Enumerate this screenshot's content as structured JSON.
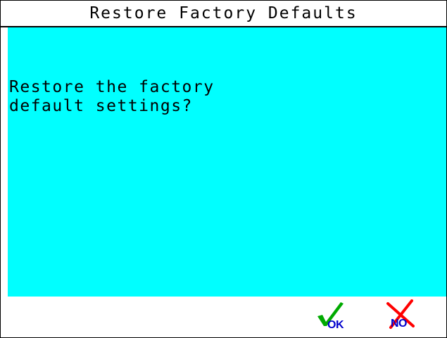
{
  "title": "Restore Factory Defaults",
  "message": {
    "line1": "Restore the factory",
    "line2": "default settings?"
  },
  "buttons": {
    "ok": {
      "label": "OK",
      "icon": "checkmark-icon",
      "color": "#00aa00"
    },
    "no": {
      "label": "NO",
      "icon": "cross-icon",
      "color": "#ff0000"
    }
  },
  "colors": {
    "background": "#00ffff",
    "label": "#0000cc"
  }
}
